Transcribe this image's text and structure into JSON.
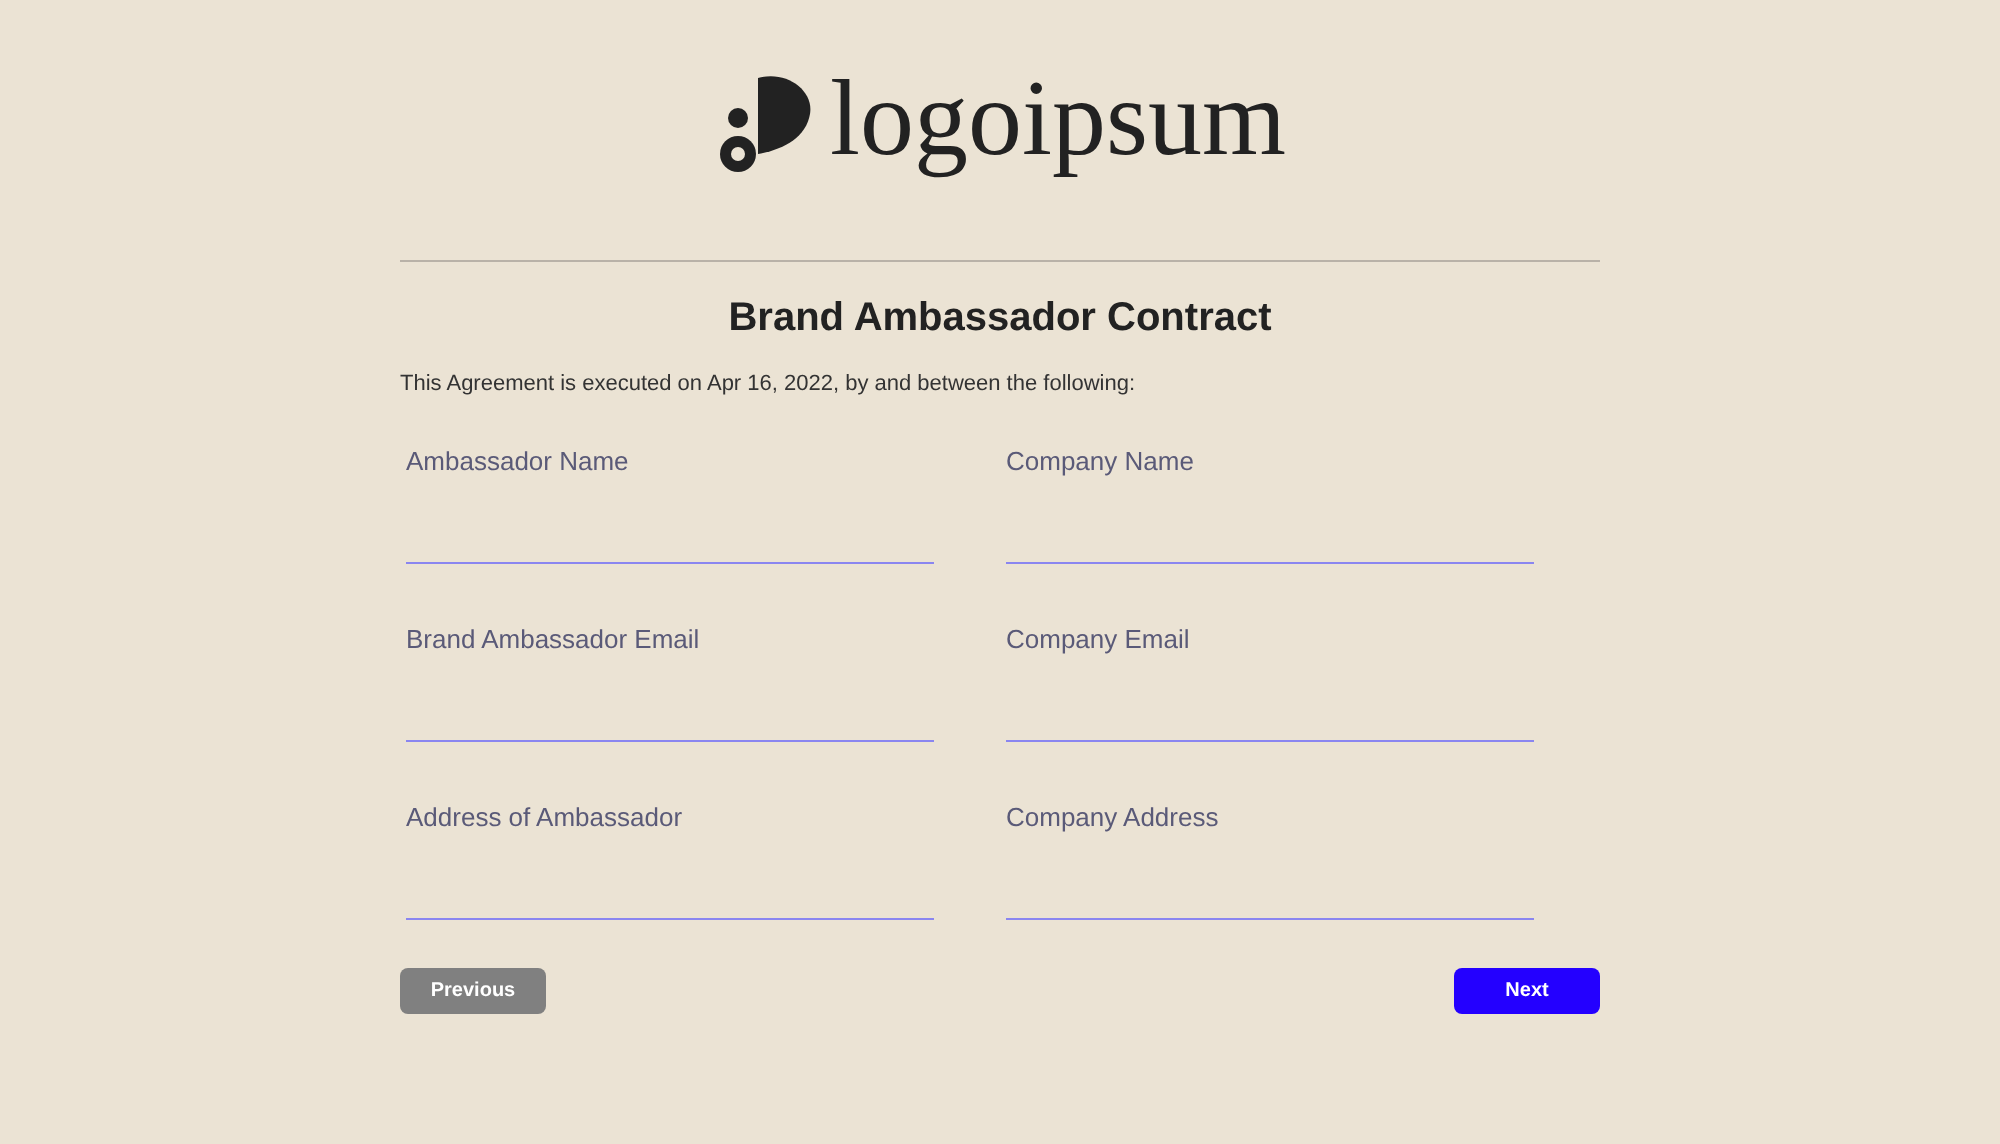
{
  "logo": {
    "text": "logoipsum"
  },
  "title": "Brand Ambassador Contract",
  "intro": "This Agreement is executed on Apr 16, 2022, by and between the following:",
  "fields": [
    {
      "label": "Ambassador Name"
    },
    {
      "label": "Company Name"
    },
    {
      "label": "Brand Ambassador Email"
    },
    {
      "label": "Company Email"
    },
    {
      "label": "Address of Ambassador"
    },
    {
      "label": "Company Address"
    }
  ],
  "buttons": {
    "previous": "Previous",
    "next": "Next"
  }
}
